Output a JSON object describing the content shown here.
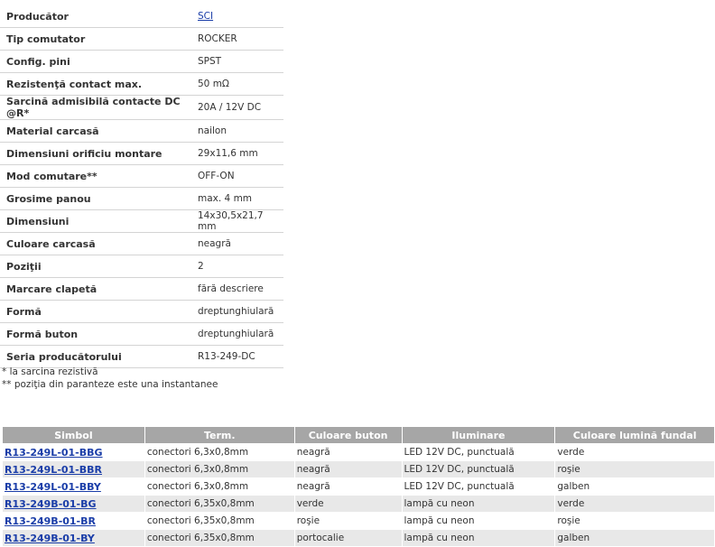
{
  "specs": [
    {
      "label": "Producător",
      "value": "SCI",
      "link": true
    },
    {
      "label": "Tip comutator",
      "value": "ROCKER"
    },
    {
      "label": "Config. pini",
      "value": "SPST"
    },
    {
      "label": "Rezistenţă contact max.",
      "value": "50 mΩ"
    },
    {
      "label": "Sarcină admisibilă contacte DC @R*",
      "value": "20A / 12V DC"
    },
    {
      "label": "Material carcasă",
      "value": "nailon"
    },
    {
      "label": "Dimensiuni orificiu montare",
      "value": "29x11,6 mm"
    },
    {
      "label": "Mod comutare**",
      "value": "OFF-ON"
    },
    {
      "label": "Grosime panou",
      "value": "max. 4 mm"
    },
    {
      "label": "Dimensiuni",
      "value": "14x30,5x21,7 mm"
    },
    {
      "label": "Culoare carcasă",
      "value": "neagră"
    },
    {
      "label": "Poziţii",
      "value": "2"
    },
    {
      "label": "Marcare clapetă",
      "value": "fără descriere"
    },
    {
      "label": "Formă",
      "value": "dreptunghiulară"
    },
    {
      "label": "Formă buton",
      "value": "dreptunghiulară"
    },
    {
      "label": "Seria producătorului",
      "value": "R13-249-DC"
    }
  ],
  "notes": {
    "note1": "* la sarcina rezistivă",
    "note2": "** poziţia din paranteze este una instantanee"
  },
  "products": {
    "headers": [
      "Simbol",
      "Term.",
      "Culoare buton",
      "Iluminare",
      "Culoare lumină fundal"
    ],
    "rows": [
      [
        "R13-249L-01-BBG",
        "conectori 6,3x0,8mm",
        "neagră",
        "LED 12V DC, punctuală",
        "verde"
      ],
      [
        "R13-249L-01-BBR",
        "conectori 6,3x0,8mm",
        "neagră",
        "LED 12V DC, punctuală",
        "roşie"
      ],
      [
        "R13-249L-01-BBY",
        "conectori 6,3x0,8mm",
        "neagră",
        "LED 12V DC, punctuală",
        "galben"
      ],
      [
        "R13-249B-01-BG",
        "conectori 6,35x0,8mm",
        "verde",
        "lampă cu neon",
        "verde"
      ],
      [
        "R13-249B-01-BR",
        "conectori 6,35x0,8mm",
        "roşie",
        "lampă cu neon",
        "roşie"
      ],
      [
        "R13-249B-01-BY",
        "conectori 6,35x0,8mm",
        "portocalie",
        "lampă cu neon",
        "galben"
      ]
    ]
  },
  "colors": {
    "header_bg": "#a6a6a6",
    "alt_row_bg": "#e8e8e8",
    "link": "#1a3da8"
  }
}
